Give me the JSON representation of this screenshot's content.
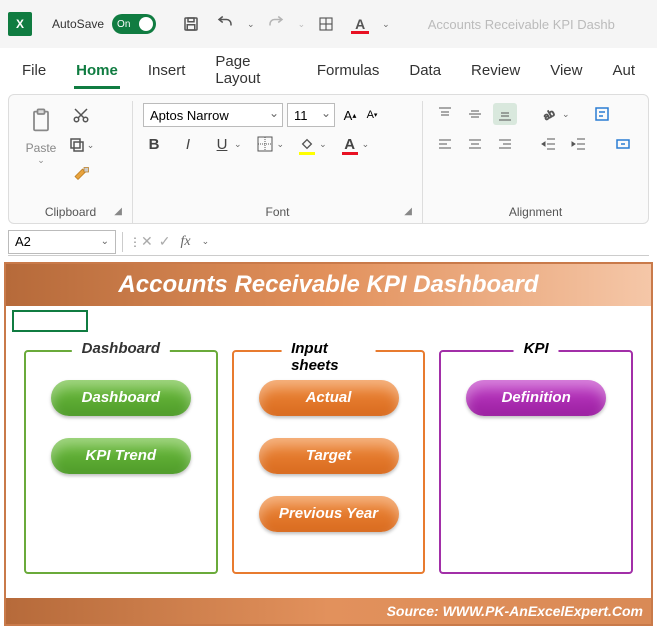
{
  "titlebar": {
    "autosave_label": "AutoSave",
    "autosave_state": "On",
    "doc_title": "Accounts Receivable KPI Dashb"
  },
  "menu": {
    "items": [
      "File",
      "Home",
      "Insert",
      "Page Layout",
      "Formulas",
      "Data",
      "Review",
      "View",
      "Aut"
    ],
    "active_index": 1
  },
  "ribbon": {
    "clipboard": {
      "paste": "Paste",
      "label": "Clipboard"
    },
    "font": {
      "name": "Aptos Narrow",
      "size": "11",
      "bold": "B",
      "italic": "I",
      "underline": "U",
      "label": "Font"
    },
    "alignment": {
      "label": "Alignment"
    }
  },
  "fxbar": {
    "cell_ref": "A2"
  },
  "dashboard": {
    "banner": "Accounts Receivable KPI Dashboard",
    "cards": [
      {
        "title": "Dashboard",
        "color": "green",
        "buttons": [
          "Dashboard",
          "KPI Trend"
        ]
      },
      {
        "title": "Input sheets",
        "color": "orange",
        "buttons": [
          "Actual",
          "Target",
          "Previous Year"
        ]
      },
      {
        "title": "KPI",
        "color": "purple",
        "buttons": [
          "Definition"
        ]
      }
    ],
    "footer": "Source: WWW.PK-AnExcelExpert.Com"
  }
}
